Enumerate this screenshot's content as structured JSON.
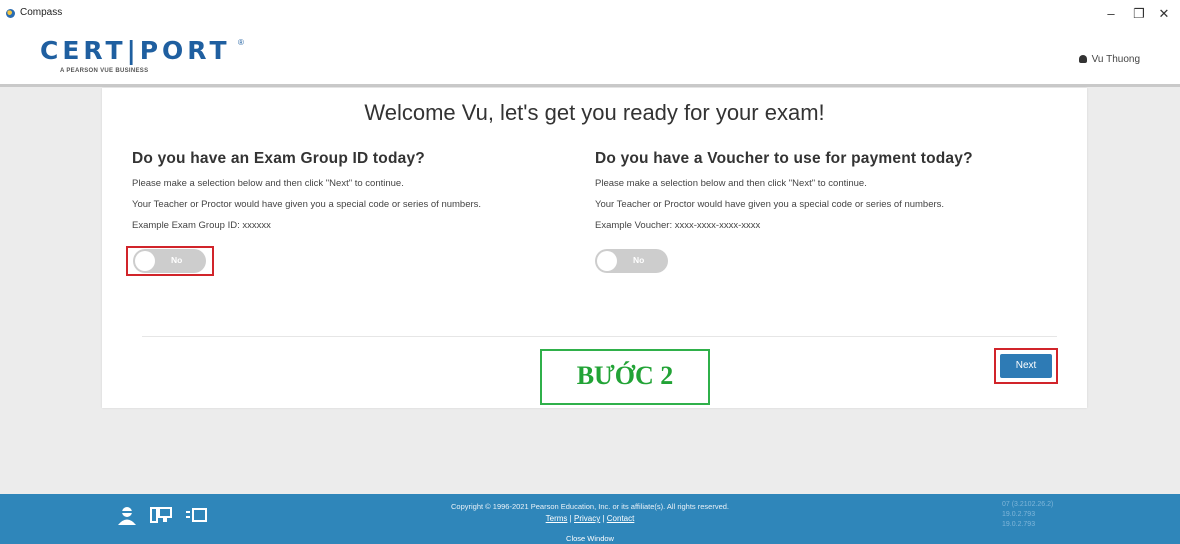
{
  "window": {
    "title": "Compass",
    "minimize": "–",
    "maximize": "❐",
    "close": "✕"
  },
  "header": {
    "logo_text": "CERT|PORT",
    "logo_tm": "®",
    "logo_sub": "A PEARSON VUE BUSINESS",
    "user_name": "Vu Thuong"
  },
  "main": {
    "welcome": "Welcome Vu, let's get you ready for your exam!",
    "exam_group": {
      "heading": "Do you have an Exam Group ID today?",
      "instruction": "Please make a selection below and then click \"Next\" to continue.",
      "hint": "Your Teacher or Proctor would have given you a special code or series of numbers.",
      "example": "Example Exam Group ID: xxxxxx",
      "toggle_label": "No"
    },
    "voucher": {
      "heading": "Do you have a Voucher to use for payment today?",
      "instruction": "Please make a selection below and then click \"Next\" to continue.",
      "hint": "Your Teacher or Proctor would have given you a special code or series of numbers.",
      "example": "Example Voucher: xxxx-xxxx-xxxx-xxxx",
      "toggle_label": "No"
    },
    "step_label": "BƯỚC 2",
    "next_label": "Next"
  },
  "footer": {
    "copyright": "Copyright © 1996-2021 Pearson Education, Inc. or its affiliate(s). All rights reserved.",
    "terms": "Terms",
    "privacy": "Privacy",
    "contact": "Contact",
    "separator": "|",
    "close_window": "Close Window",
    "versions": [
      "07 (3.2102.26.2)",
      "19.0.2.793",
      "19.0.2.793"
    ]
  },
  "colors": {
    "accent": "#2e7bb5",
    "footer": "#2f86ba",
    "highlight_red": "#d1242a",
    "highlight_green": "#2fb04a"
  }
}
